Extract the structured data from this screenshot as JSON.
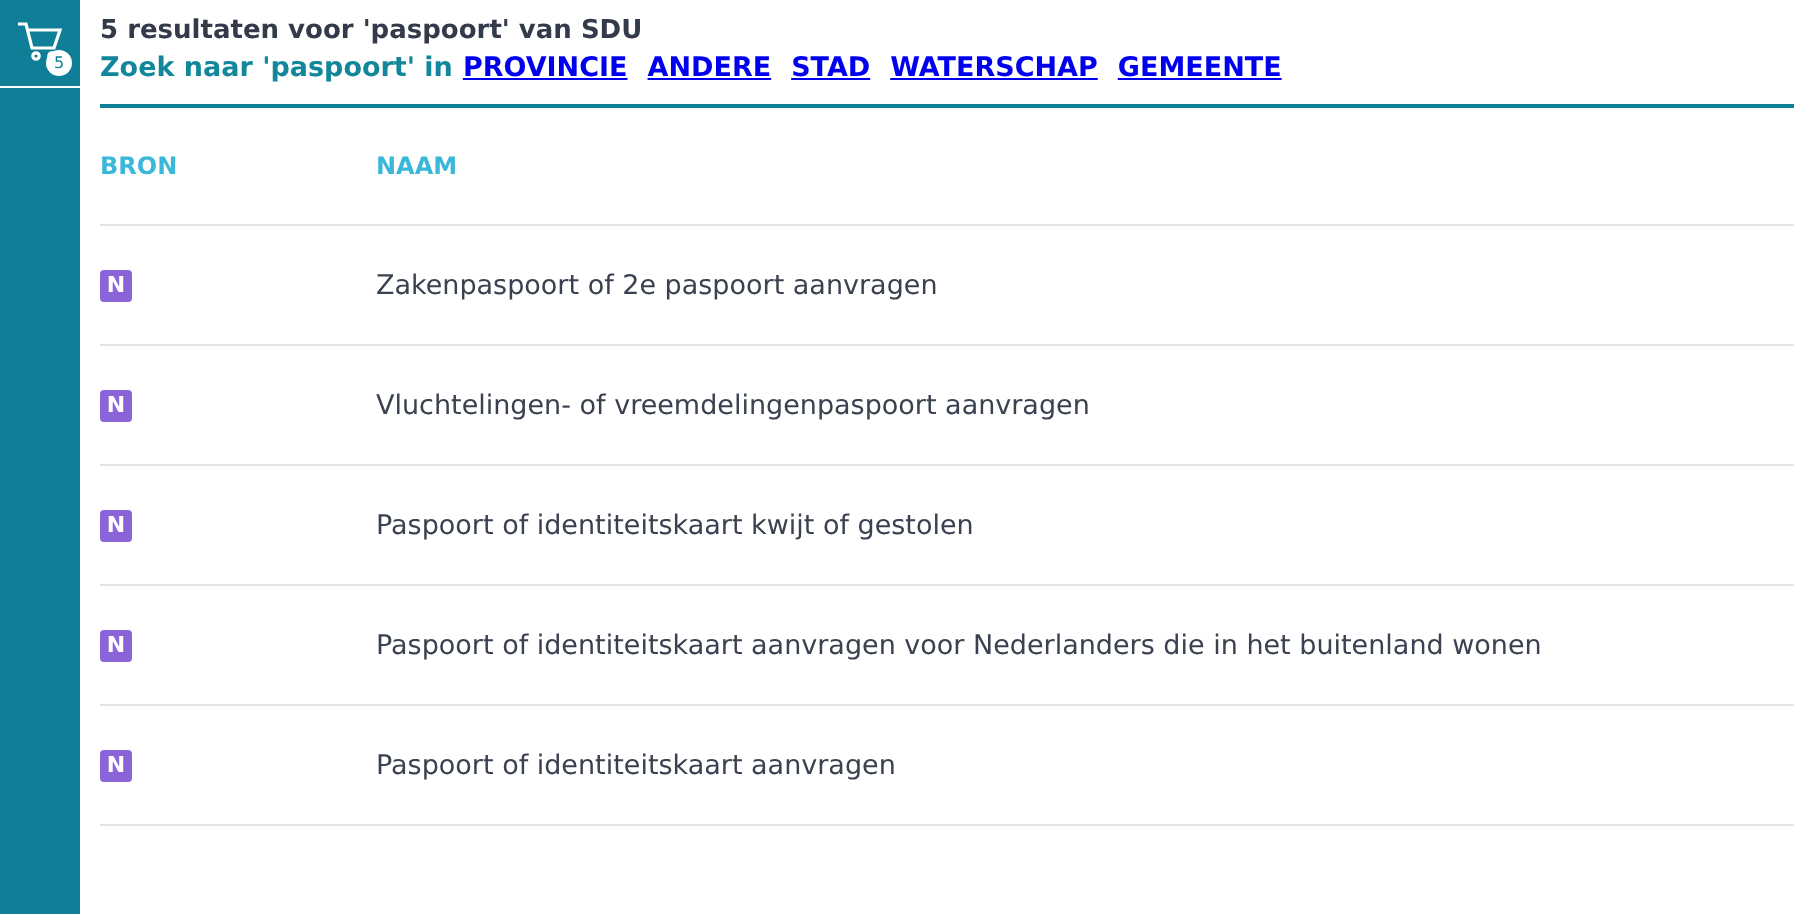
{
  "cart": {
    "count": "5"
  },
  "title": "5 resultaten voor 'paspoort' van SDU",
  "search_in": {
    "label": "Zoek naar 'paspoort' in",
    "links": [
      "PROVINCIE",
      "ANDERE",
      "STAD",
      "WATERSCHAP",
      "GEMEENTE"
    ]
  },
  "table": {
    "columns": [
      "BRON",
      "NAAM"
    ],
    "rows": [
      {
        "source": "N",
        "name": "Zakenpaspoort of 2e paspoort aanvragen"
      },
      {
        "source": "N",
        "name": "Vluchtelingen- of vreemdelingenpaspoort aanvragen"
      },
      {
        "source": "N",
        "name": "Paspoort of identiteitskaart kwijt of gestolen"
      },
      {
        "source": "N",
        "name": "Paspoort of identiteitskaart aanvragen voor Nederlanders die in het buitenland wonen"
      },
      {
        "source": "N",
        "name": "Paspoort of identiteitskaart aanvragen"
      }
    ]
  }
}
